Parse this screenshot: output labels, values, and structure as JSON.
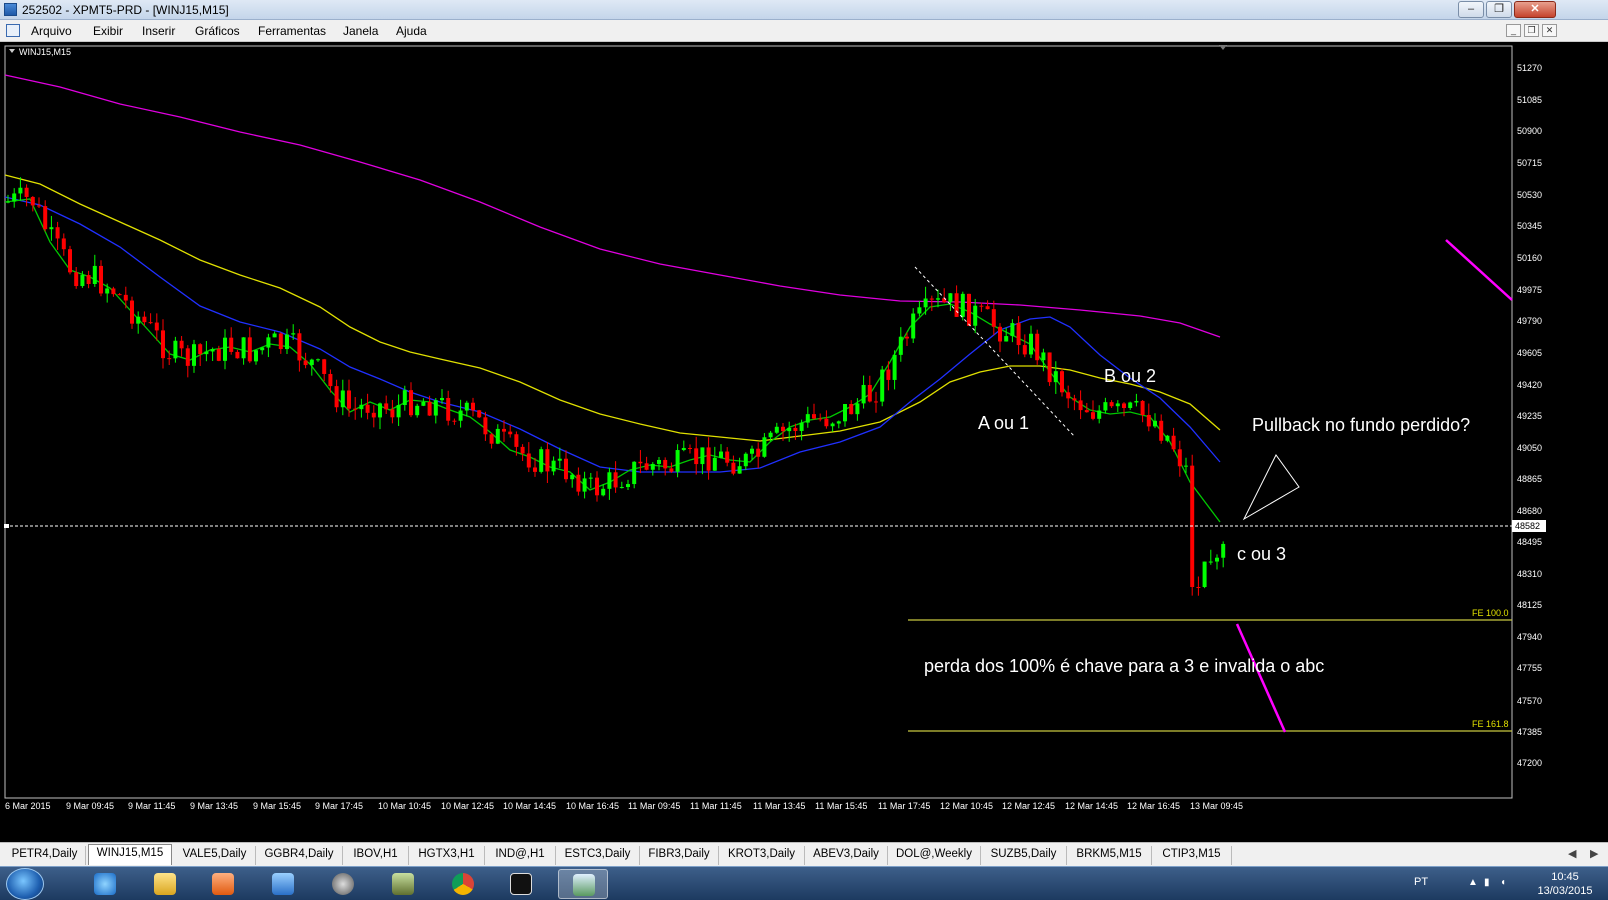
{
  "window": {
    "title": "252502 - XPMT5-PRD - [WINJ15,M15]"
  },
  "menu": [
    "Arquivo",
    "Exibir",
    "Inserir",
    "Gráficos",
    "Ferramentas",
    "Janela",
    "Ajuda"
  ],
  "chart": {
    "symbol_label": "WINJ15,M15",
    "price_levels": [
      "51270",
      "51085",
      "50900",
      "50715",
      "50530",
      "50345",
      "50160",
      "49975",
      "49790",
      "49605",
      "49420",
      "49235",
      "49050",
      "48865",
      "48680",
      "48495",
      "48310",
      "48125",
      "47940",
      "47755",
      "47570",
      "47385",
      "47200"
    ],
    "current_price": "48582",
    "time_labels": [
      "6 Mar 2015",
      "9 Mar 09:45",
      "9 Mar 11:45",
      "9 Mar 13:45",
      "9 Mar 15:45",
      "9 Mar 17:45",
      "10 Mar 10:45",
      "10 Mar 12:45",
      "10 Mar 14:45",
      "10 Mar 16:45",
      "11 Mar 09:45",
      "11 Mar 11:45",
      "11 Mar 13:45",
      "11 Mar 15:45",
      "11 Mar 17:45",
      "12 Mar 10:45",
      "12 Mar 12:45",
      "12 Mar 14:45",
      "12 Mar 16:45",
      "13 Mar 09:45"
    ],
    "fe_100_label": "FE 100.0",
    "fe_161_label": "FE 161.8",
    "annotations": {
      "a_label": "A ou 1",
      "b_label": "B ou 2",
      "c_label": "c ou 3",
      "pullback_label": "Pullback no fundo perdido?",
      "loss_label": "perda dos 100%  é chave para a 3 e invalida o abc"
    },
    "colors": {
      "bull": "#00ff00",
      "bear": "#ff0000",
      "ma_fast": "#00c800",
      "ma_mid": "#2030ff",
      "ma_slow": "#e0e000",
      "ma_long": "#e000e0",
      "fib": "#c8c840",
      "trend_magenta": "#ff00ff"
    }
  },
  "tabs": [
    "PETR4,Daily",
    "WINJ15,M15",
    "VALE5,Daily",
    "GGBR4,Daily",
    "IBOV,H1",
    "HGTX3,H1",
    "IND@,H1",
    "ESTC3,Daily",
    "FIBR3,Daily",
    "KROT3,Daily",
    "ABEV3,Daily",
    "DOL@,Weekly",
    "SUZB5,Daily",
    "BRKM5,M15",
    "CTIP3,M15"
  ],
  "active_tab": "WINJ15,M15",
  "taskbar": {
    "icons": [
      "start-orb",
      "ie-icon",
      "explorer-icon",
      "media-icon",
      "outlook-icon",
      "hp-icon",
      "mediaplayer-icon",
      "chrome-icon",
      "xp-icon",
      "metatrader-icon"
    ],
    "tray": {
      "lang": "PT",
      "time": "10:45",
      "date": "13/03/2015"
    }
  }
}
